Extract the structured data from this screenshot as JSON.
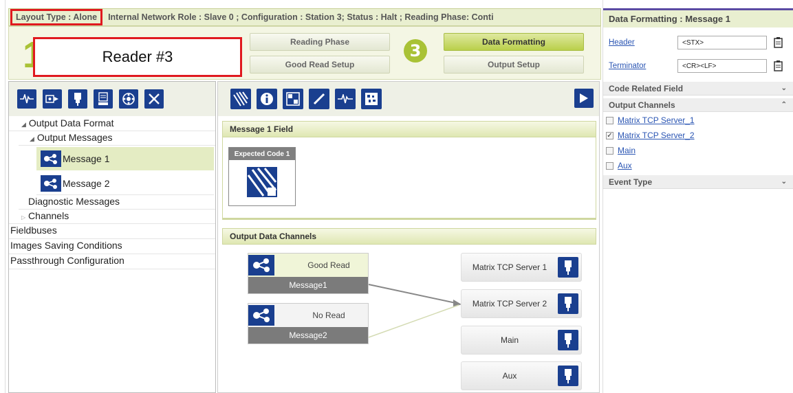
{
  "topbar": {
    "layout_type": "Layout Type : Alone",
    "status": "Internal Network Role : Slave 0 ; Configuration : Station 3; Status : Halt ; Reading Phase: Conti"
  },
  "workflow": {
    "step_number": "1",
    "reader_label": "Reader #3",
    "step3_number": "3",
    "buttons": [
      "Reading Phase",
      "Good Read Setup",
      "Data Formatting",
      "Output Setup"
    ]
  },
  "right_panel": {
    "title": "Data Formatting : Message 1",
    "header_label": "Header",
    "header_value": "<STX>",
    "terminator_label": "Terminator",
    "terminator_value": "<CR><LF>",
    "sections": {
      "code_related": "Code Related Field",
      "output_channels": "Output Channels",
      "event_type": "Event Type"
    },
    "channels": [
      {
        "label": "Matrix TCP Server_1",
        "checked": false
      },
      {
        "label": "Matrix TCP Server_2",
        "checked": true
      },
      {
        "label": "Main",
        "checked": false
      },
      {
        "label": "Aux",
        "checked": false
      }
    ]
  },
  "tree": {
    "output_data_format": "Output Data Format",
    "output_messages": "Output Messages",
    "message1": "Message 1",
    "message2": "Message 2",
    "diagnostic": "Diagnostic Messages",
    "channels": "Channels",
    "fieldbuses": "Fieldbuses",
    "images_saving": "Images Saving Conditions",
    "passthrough": "Passthrough Configuration"
  },
  "center": {
    "field_section": "Message 1 Field",
    "expected_code": "Expected Code 1",
    "odc_section": "Output Data Channels",
    "good_read": "Good Read",
    "message1": "Message1",
    "no_read": "No Read",
    "message2": "Message2",
    "ch1": "Matrix TCP Server 1",
    "ch2": "Matrix TCP Server 2",
    "ch3": "Main",
    "ch4": "Aux"
  },
  "colors": {
    "accent_green": "#a9c236",
    "icon_blue": "#1a3f8f",
    "highlight_red": "#e0191f"
  }
}
